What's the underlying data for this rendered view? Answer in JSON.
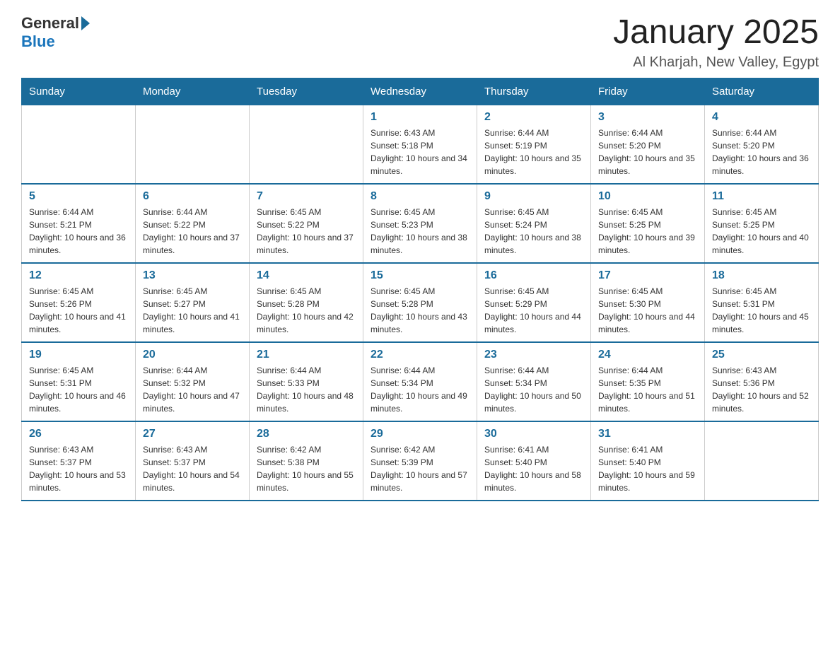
{
  "header": {
    "logo": {
      "general": "General",
      "blue": "Blue"
    },
    "title": "January 2025",
    "subtitle": "Al Kharjah, New Valley, Egypt"
  },
  "days_of_week": [
    "Sunday",
    "Monday",
    "Tuesday",
    "Wednesday",
    "Thursday",
    "Friday",
    "Saturday"
  ],
  "weeks": [
    [
      {
        "day": "",
        "sunrise": "",
        "sunset": "",
        "daylight": ""
      },
      {
        "day": "",
        "sunrise": "",
        "sunset": "",
        "daylight": ""
      },
      {
        "day": "",
        "sunrise": "",
        "sunset": "",
        "daylight": ""
      },
      {
        "day": "1",
        "sunrise": "Sunrise: 6:43 AM",
        "sunset": "Sunset: 5:18 PM",
        "daylight": "Daylight: 10 hours and 34 minutes."
      },
      {
        "day": "2",
        "sunrise": "Sunrise: 6:44 AM",
        "sunset": "Sunset: 5:19 PM",
        "daylight": "Daylight: 10 hours and 35 minutes."
      },
      {
        "day": "3",
        "sunrise": "Sunrise: 6:44 AM",
        "sunset": "Sunset: 5:20 PM",
        "daylight": "Daylight: 10 hours and 35 minutes."
      },
      {
        "day": "4",
        "sunrise": "Sunrise: 6:44 AM",
        "sunset": "Sunset: 5:20 PM",
        "daylight": "Daylight: 10 hours and 36 minutes."
      }
    ],
    [
      {
        "day": "5",
        "sunrise": "Sunrise: 6:44 AM",
        "sunset": "Sunset: 5:21 PM",
        "daylight": "Daylight: 10 hours and 36 minutes."
      },
      {
        "day": "6",
        "sunrise": "Sunrise: 6:44 AM",
        "sunset": "Sunset: 5:22 PM",
        "daylight": "Daylight: 10 hours and 37 minutes."
      },
      {
        "day": "7",
        "sunrise": "Sunrise: 6:45 AM",
        "sunset": "Sunset: 5:22 PM",
        "daylight": "Daylight: 10 hours and 37 minutes."
      },
      {
        "day": "8",
        "sunrise": "Sunrise: 6:45 AM",
        "sunset": "Sunset: 5:23 PM",
        "daylight": "Daylight: 10 hours and 38 minutes."
      },
      {
        "day": "9",
        "sunrise": "Sunrise: 6:45 AM",
        "sunset": "Sunset: 5:24 PM",
        "daylight": "Daylight: 10 hours and 38 minutes."
      },
      {
        "day": "10",
        "sunrise": "Sunrise: 6:45 AM",
        "sunset": "Sunset: 5:25 PM",
        "daylight": "Daylight: 10 hours and 39 minutes."
      },
      {
        "day": "11",
        "sunrise": "Sunrise: 6:45 AM",
        "sunset": "Sunset: 5:25 PM",
        "daylight": "Daylight: 10 hours and 40 minutes."
      }
    ],
    [
      {
        "day": "12",
        "sunrise": "Sunrise: 6:45 AM",
        "sunset": "Sunset: 5:26 PM",
        "daylight": "Daylight: 10 hours and 41 minutes."
      },
      {
        "day": "13",
        "sunrise": "Sunrise: 6:45 AM",
        "sunset": "Sunset: 5:27 PM",
        "daylight": "Daylight: 10 hours and 41 minutes."
      },
      {
        "day": "14",
        "sunrise": "Sunrise: 6:45 AM",
        "sunset": "Sunset: 5:28 PM",
        "daylight": "Daylight: 10 hours and 42 minutes."
      },
      {
        "day": "15",
        "sunrise": "Sunrise: 6:45 AM",
        "sunset": "Sunset: 5:28 PM",
        "daylight": "Daylight: 10 hours and 43 minutes."
      },
      {
        "day": "16",
        "sunrise": "Sunrise: 6:45 AM",
        "sunset": "Sunset: 5:29 PM",
        "daylight": "Daylight: 10 hours and 44 minutes."
      },
      {
        "day": "17",
        "sunrise": "Sunrise: 6:45 AM",
        "sunset": "Sunset: 5:30 PM",
        "daylight": "Daylight: 10 hours and 44 minutes."
      },
      {
        "day": "18",
        "sunrise": "Sunrise: 6:45 AM",
        "sunset": "Sunset: 5:31 PM",
        "daylight": "Daylight: 10 hours and 45 minutes."
      }
    ],
    [
      {
        "day": "19",
        "sunrise": "Sunrise: 6:45 AM",
        "sunset": "Sunset: 5:31 PM",
        "daylight": "Daylight: 10 hours and 46 minutes."
      },
      {
        "day": "20",
        "sunrise": "Sunrise: 6:44 AM",
        "sunset": "Sunset: 5:32 PM",
        "daylight": "Daylight: 10 hours and 47 minutes."
      },
      {
        "day": "21",
        "sunrise": "Sunrise: 6:44 AM",
        "sunset": "Sunset: 5:33 PM",
        "daylight": "Daylight: 10 hours and 48 minutes."
      },
      {
        "day": "22",
        "sunrise": "Sunrise: 6:44 AM",
        "sunset": "Sunset: 5:34 PM",
        "daylight": "Daylight: 10 hours and 49 minutes."
      },
      {
        "day": "23",
        "sunrise": "Sunrise: 6:44 AM",
        "sunset": "Sunset: 5:34 PM",
        "daylight": "Daylight: 10 hours and 50 minutes."
      },
      {
        "day": "24",
        "sunrise": "Sunrise: 6:44 AM",
        "sunset": "Sunset: 5:35 PM",
        "daylight": "Daylight: 10 hours and 51 minutes."
      },
      {
        "day": "25",
        "sunrise": "Sunrise: 6:43 AM",
        "sunset": "Sunset: 5:36 PM",
        "daylight": "Daylight: 10 hours and 52 minutes."
      }
    ],
    [
      {
        "day": "26",
        "sunrise": "Sunrise: 6:43 AM",
        "sunset": "Sunset: 5:37 PM",
        "daylight": "Daylight: 10 hours and 53 minutes."
      },
      {
        "day": "27",
        "sunrise": "Sunrise: 6:43 AM",
        "sunset": "Sunset: 5:37 PM",
        "daylight": "Daylight: 10 hours and 54 minutes."
      },
      {
        "day": "28",
        "sunrise": "Sunrise: 6:42 AM",
        "sunset": "Sunset: 5:38 PM",
        "daylight": "Daylight: 10 hours and 55 minutes."
      },
      {
        "day": "29",
        "sunrise": "Sunrise: 6:42 AM",
        "sunset": "Sunset: 5:39 PM",
        "daylight": "Daylight: 10 hours and 57 minutes."
      },
      {
        "day": "30",
        "sunrise": "Sunrise: 6:41 AM",
        "sunset": "Sunset: 5:40 PM",
        "daylight": "Daylight: 10 hours and 58 minutes."
      },
      {
        "day": "31",
        "sunrise": "Sunrise: 6:41 AM",
        "sunset": "Sunset: 5:40 PM",
        "daylight": "Daylight: 10 hours and 59 minutes."
      },
      {
        "day": "",
        "sunrise": "",
        "sunset": "",
        "daylight": ""
      }
    ]
  ]
}
